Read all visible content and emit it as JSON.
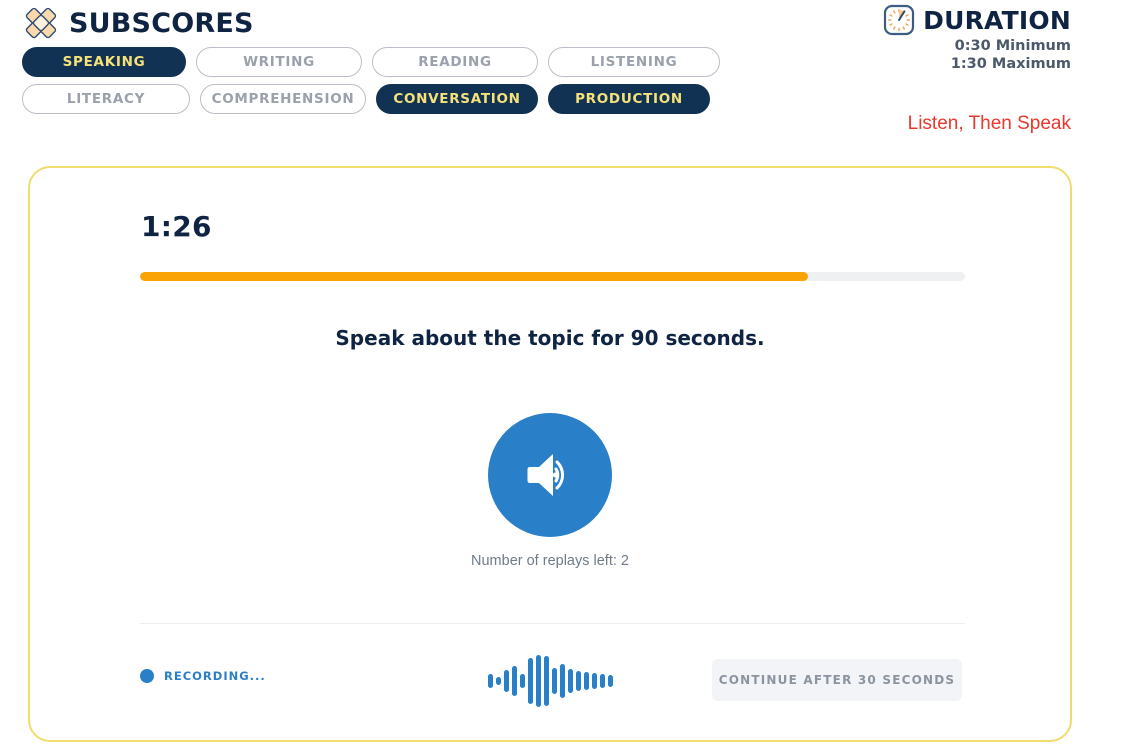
{
  "header": {
    "subscores_label": "SUBSCORES",
    "logo_icon": "diamond-lattice-logo",
    "tab_rows": [
      [
        {
          "label": "SPEAKING",
          "active": true,
          "key": "speaking"
        },
        {
          "label": "WRITING",
          "active": false,
          "key": "writing"
        },
        {
          "label": "READING",
          "active": false,
          "key": "reading"
        },
        {
          "label": "LISTENING",
          "active": false,
          "key": "listening"
        }
      ],
      [
        {
          "label": "LITERACY",
          "active": false,
          "key": "literacy"
        },
        {
          "label": "COMPREHENSION",
          "active": false,
          "key": "comprehension"
        },
        {
          "label": "CONVERSATION",
          "active": true,
          "key": "conversation"
        },
        {
          "label": "PRODUCTION",
          "active": true,
          "key": "production"
        }
      ]
    ]
  },
  "duration": {
    "clock_icon": "clock-icon",
    "label": "DURATION",
    "minimum": "0:30 Minimum",
    "maximum": "1:30 Maximum"
  },
  "task_type": "Listen, Then Speak",
  "card": {
    "timer": "1:26",
    "progress_percent": 81,
    "instruction": "Speak about the topic for 90 seconds.",
    "speaker_icon": "speaker-volume-icon",
    "replays_text": "Number of replays left: 2",
    "recording_label": "RECORDING...",
    "recording_dot_icon": "record-dot-icon",
    "waveform_icon": "audio-waveform-icon",
    "waveform_bars": [
      14,
      8,
      22,
      30,
      14,
      46,
      52,
      50,
      26,
      34,
      24,
      20,
      18,
      16,
      14,
      12
    ],
    "continue_label": "CONTINUE AFTER 30 SECONDS"
  },
  "colors": {
    "navy": "#123253",
    "yellow_text": "#f5e27a",
    "card_border": "#f0dc6e",
    "progress": "#faa307",
    "blue": "#2a7fc9",
    "red": "#e8382c",
    "gray_text": "#9aa1ab"
  }
}
